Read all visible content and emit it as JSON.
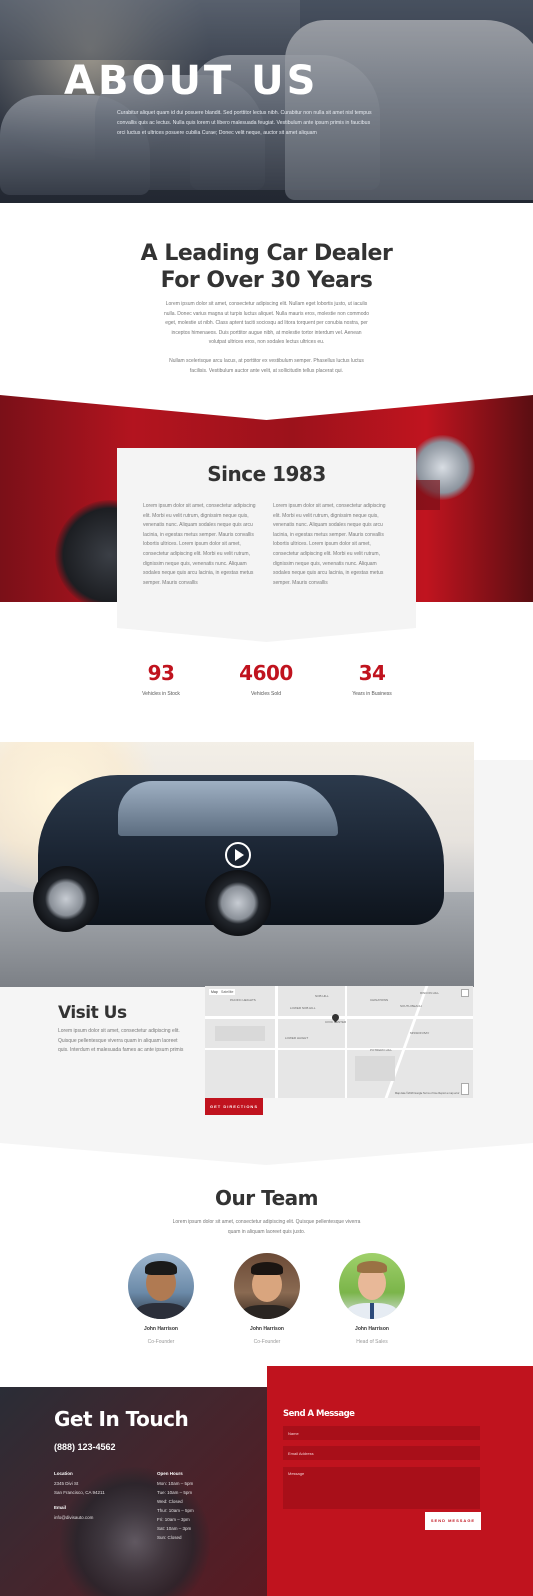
{
  "hero": {
    "title": "ABOUT US",
    "text": "Curabitur aliquet quam id dui posuere blandit. Sed porttitor lectus nibh. Curabitur non nulla sit amet nisl tempus convallis quis ac lectus. Nulla quis lorem ut libero malesuada feugiat. Vestibulum ante ipsum primis in faucibus orci luctus et ultrices posuere cubilia Curae; Donec velit neque, auctor sit amet aliquam"
  },
  "leading": {
    "title": "A Leading Car Dealer For Over 30 Years",
    "para1": "Lorem ipsum dolor sit amet, consectetur adipiscing elit. Nullam eget lobortis justo, ut iaculis nulla. Donec varius magna ut turpis luctus aliquet. Nulla mauris eros, molestie non commodo eget, molestie ut nibh. Class aptent taciti sociosqu ad litora torquent per conubia nostra, per inceptos himenaeos. Duis porttitor augue nibh, at molestie tortor interdum vel. Aenean volutpat ultrices eros, non sodales lectus ultrices eu.",
    "para2": "Nullam scelerisque arcu lacus, at porttitor ex vestibulum semper. Phasellus luctus luctus facilisis. Vestibulum auctor ante velit, at sollicitudin tellus placerat qui."
  },
  "since": {
    "title": "Since 1983",
    "col1": "Lorem ipsum dolor sit amet, consectetur adipiscing elit. Morbi eu velit rutrum, dignissim neque quis, venenatis nunc. Aliquam sodales neque quis arcu lacinia, in egestas metus semper. Mauris convallis lobortis ultrices. Lorem ipsum dolor sit amet, consectetur adipiscing elit. Morbi eu velit rutrum, dignissim neque quis, venenatis nunc. Aliquam sodales neque quis arcu lacinia, in egestas metus semper. Mauris convallis",
    "col2": "Lorem ipsum dolor sit amet, consectetur adipiscing elit. Morbi eu velit rutrum, dignissim neque quis, venenatis nunc. Aliquam sodales neque quis arcu lacinia, in egestas metus semper. Mauris convallis lobortis ultrices. Lorem ipsum dolor sit amet, consectetur adipiscing elit. Morbi eu velit rutrum, dignissim neque quis, venenatis nunc. Aliquam sodales neque quis arcu lacinia, in egestas metus semper. Mauris convallis"
  },
  "stats": [
    {
      "value": "93",
      "label": "Vehicles in Stock"
    },
    {
      "value": "4600",
      "label": "Vehicles Sold"
    },
    {
      "value": "34",
      "label": "Years in Business"
    }
  ],
  "visit": {
    "title": "Visit Us",
    "text": "Lorem ipsum dolor sit amet, consectetur adipiscing elit. Quisque pellentesque viverra quam in aliquam laoreet quis. Interdum et malesuada fames ac ante ipsum primis",
    "button": "GET DIRECTIONS",
    "map_tabs": [
      "Map",
      "Satellite"
    ],
    "map_labels": [
      "PACIFIC HEIGHTS",
      "LOWER NOB HILL",
      "NOB HILL",
      "SOUTH BEACH",
      "MISSION BAY",
      "RINCON HILL",
      "LOWER HAIGHT",
      "CIVIC CENTER",
      "POTRERO HILL",
      "CHINATOWN"
    ],
    "map_footer": "Map data ©2018 Google  Terms of Use  Report a map error"
  },
  "team": {
    "title": "Our Team",
    "intro": "Lorem ipsum dolor sit amet, consectetur adipiscing elit. Quisque pellentesque viverra quam in aliquam laoreet quis justo.",
    "members": [
      {
        "name": "John Harrison",
        "role": "Co-Founder"
      },
      {
        "name": "John Harrison",
        "role": "Co-Founder"
      },
      {
        "name": "John Harrison",
        "role": "Head of Sales"
      }
    ]
  },
  "contact": {
    "title": "Get In Touch",
    "phone": "(888) 123-4562",
    "location_head": "Location",
    "location_lines": [
      "2345 Divi St",
      "San Francisco, CA 94211"
    ],
    "email_head": "Email",
    "email": "info@divisauto.com",
    "hours_head": "Open Hours",
    "hours": [
      "Mon: 10am – 5pm",
      "Tue: 10am – 5pm",
      "Wed: Closed",
      "Thur: 10am – 5pm",
      "Fri: 10am – 3pm",
      "Sat: 10am – 3pm",
      "Sun: Closed"
    ],
    "form_title": "Send A Message",
    "name_placeholder": "Name",
    "email_placeholder": "Email Address",
    "message_placeholder": "Message",
    "send_button": "SEND MESSAGE"
  },
  "colors": {
    "accent": "#c0131e",
    "dark": "#333333"
  }
}
